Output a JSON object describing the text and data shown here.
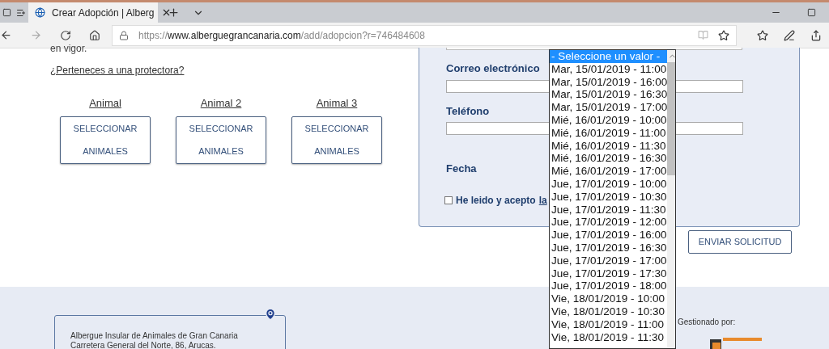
{
  "browser": {
    "tabs": [
      {
        "title": "Crear Adopción | Alberg",
        "selected": true
      }
    ],
    "address": {
      "scheme": "https://",
      "domain": "www.alberguegrancanaria.com",
      "path": "/add/adopcion?r=746484608"
    }
  },
  "page": {
    "intro_text": "en vigor.",
    "protector_link": "¿Perteneces a una protectora?",
    "animals": [
      {
        "label": "Animal",
        "button": "SELECCIONAR ANIMALES"
      },
      {
        "label": "Animal 2",
        "button": "SELECCIONAR ANIMALES"
      },
      {
        "label": "Animal 3",
        "button": "SELECCIONAR ANIMALES"
      }
    ]
  },
  "form": {
    "fields": [
      {
        "label": "Correo electrónico"
      },
      {
        "label": "Teléfono"
      }
    ],
    "date_label": "Fecha",
    "terms": {
      "label": "He leido y acepto",
      "link": "la",
      "checked": false
    },
    "submit": "ENVIAR SOLICITUD"
  },
  "date_dropdown": {
    "options": [
      {
        "label": "- Seleccione un valor -",
        "selected": true
      },
      {
        "label": "Mar, 15/01/2019 - 11:00",
        "selected": false
      },
      {
        "label": "Mar, 15/01/2019 - 16:00",
        "selected": false
      },
      {
        "label": "Mar, 15/01/2019 - 16:30",
        "selected": false
      },
      {
        "label": "Mar, 15/01/2019 - 17:00",
        "selected": false
      },
      {
        "label": "Mié, 16/01/2019 - 10:00",
        "selected": false
      },
      {
        "label": "Mié, 16/01/2019 - 11:00",
        "selected": false
      },
      {
        "label": "Mié, 16/01/2019 - 11:30",
        "selected": false
      },
      {
        "label": "Mié, 16/01/2019 - 16:30",
        "selected": false
      },
      {
        "label": "Mié, 16/01/2019 - 17:00",
        "selected": false
      },
      {
        "label": "Jue, 17/01/2019 - 10:00",
        "selected": false
      },
      {
        "label": "Jue, 17/01/2019 - 10:30",
        "selected": false
      },
      {
        "label": "Jue, 17/01/2019 - 11:30",
        "selected": false
      },
      {
        "label": "Jue, 17/01/2019 - 12:00",
        "selected": false
      },
      {
        "label": "Jue, 17/01/2019 - 16:00",
        "selected": false
      },
      {
        "label": "Jue, 17/01/2019 - 16:30",
        "selected": false
      },
      {
        "label": "Jue, 17/01/2019 - 17:00",
        "selected": false
      },
      {
        "label": "Jue, 17/01/2019 - 17:30",
        "selected": false
      },
      {
        "label": "Jue, 17/01/2019 - 18:00",
        "selected": false
      },
      {
        "label": "Vie, 18/01/2019 - 10:00",
        "selected": false
      },
      {
        "label": "Vie, 18/01/2019 - 10:30",
        "selected": false
      },
      {
        "label": "Vie, 18/01/2019 - 11:00",
        "selected": false
      },
      {
        "label": "Vie, 18/01/2019 - 11:30",
        "selected": false
      }
    ]
  },
  "footer": {
    "address_lines": [
      "Albergue Insular de Animales de Gran Canaria",
      "Carretera General del Norte, 86, Arucas."
    ],
    "managed_by": "Gestionado por:"
  }
}
